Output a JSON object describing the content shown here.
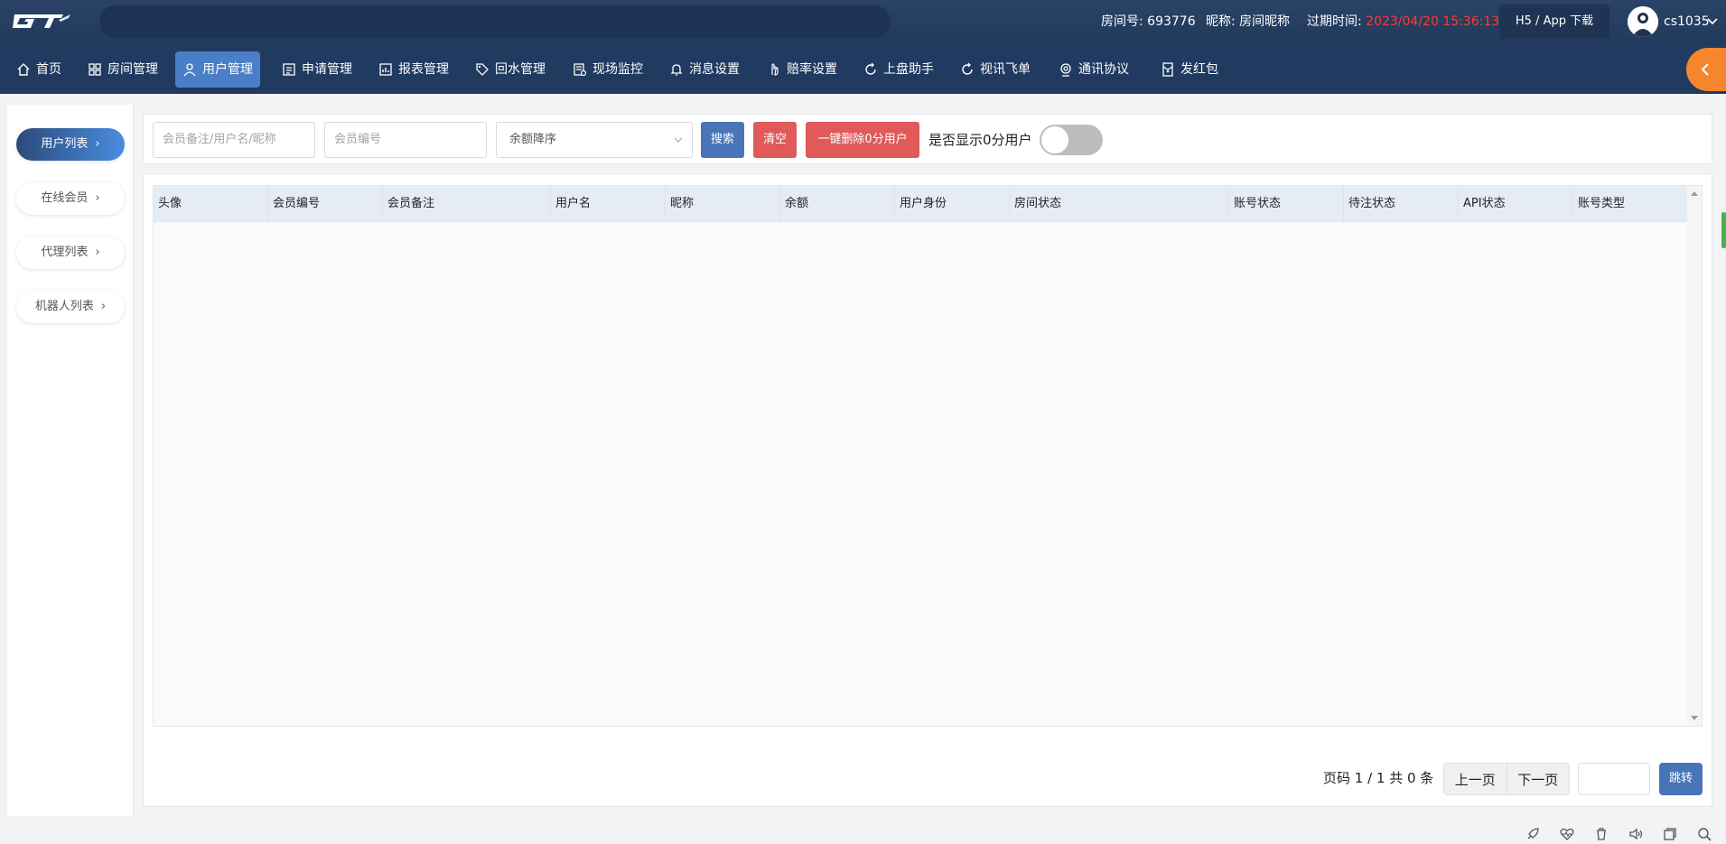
{
  "app": {
    "logo_text": "GTI"
  },
  "header": {
    "room_label": "房间号: ",
    "room_value": "693776",
    "nickname_label": "昵称: ",
    "nickname_value": "房间昵称",
    "expire_label": "过期时间: ",
    "expire_value": "2023/04/20 15:36:13",
    "app_download": "H5 / App 下载",
    "username": "cs1035"
  },
  "nav": {
    "items": [
      {
        "label": "首页",
        "icon": "home-icon"
      },
      {
        "label": "房间管理",
        "icon": "grid-icon"
      },
      {
        "label": "用户管理",
        "icon": "user-icon",
        "active": true
      },
      {
        "label": "申请管理",
        "icon": "form-icon"
      },
      {
        "label": "报表管理",
        "icon": "report-icon"
      },
      {
        "label": "回水管理",
        "icon": "tag-icon"
      },
      {
        "label": "现场监控",
        "icon": "monitor-doc-icon"
      },
      {
        "label": "消息设置",
        "icon": "bell-icon"
      },
      {
        "label": "赔率设置",
        "icon": "hand-icon"
      },
      {
        "label": "上盘助手",
        "icon": "refresh-icon"
      },
      {
        "label": "视讯飞单",
        "icon": "refresh-icon"
      },
      {
        "label": "通讯协议",
        "icon": "webcam-icon"
      },
      {
        "label": "发红包",
        "icon": "envelope-icon"
      }
    ]
  },
  "sidebar": {
    "items": [
      {
        "label": "用户列表",
        "active": true
      },
      {
        "label": "在线会员"
      },
      {
        "label": "代理列表"
      },
      {
        "label": "机器人列表"
      }
    ]
  },
  "filters": {
    "search_placeholder": "会员备注/用户名/昵称",
    "member_no_placeholder": "会员编号",
    "sort_value": "余额降序",
    "search_btn": "搜索",
    "clear_btn": "清空",
    "delete_zero_btn": "一键删除0分用户",
    "show_zero_label": "是否显示0分用户",
    "show_zero_on": false
  },
  "table": {
    "columns": [
      "头像",
      "会员编号",
      "会员备注",
      "用户名",
      "昵称",
      "余额",
      "用户身份",
      "房间状态",
      "账号状态",
      "待注状态",
      "API状态",
      "账号类型"
    ],
    "rows": []
  },
  "pager": {
    "info": "页码 1 / 1 共 0 条",
    "prev": "上一页",
    "next": "下一页",
    "jump": "跳转"
  },
  "colors": {
    "topbar": "#223a5c",
    "navbar": "#203a60",
    "nav_active": "#4a7fc7",
    "expire_red": "#ff3b30",
    "btn_blue": "#4a74b8",
    "btn_red": "#e05a5a",
    "orange_toggle": "#f5862d"
  }
}
